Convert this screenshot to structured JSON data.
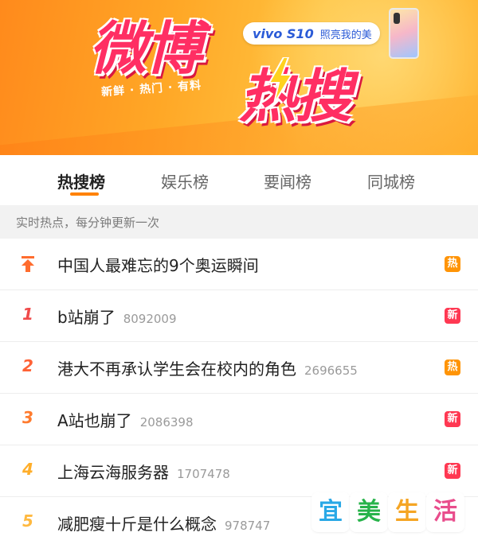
{
  "banner": {
    "title_main": "微博",
    "title_hot": "热搜",
    "subtitle": "新鲜 · 热门 · 有料",
    "ad_brand": "vivo S10",
    "ad_text": "照亮我的美"
  },
  "tabs": [
    {
      "label": "热搜榜",
      "active": true
    },
    {
      "label": "娱乐榜",
      "active": false
    },
    {
      "label": "要闻榜",
      "active": false
    },
    {
      "label": "同城榜",
      "active": false
    }
  ],
  "notice": "实时热点，每分钟更新一次",
  "rows": [
    {
      "rank": "",
      "pinned": true,
      "title": "中国人最难忘的9个奥运瞬间",
      "count": "",
      "badge": "热"
    },
    {
      "rank": "1",
      "title": "b站崩了",
      "count": "8092009",
      "badge": "新"
    },
    {
      "rank": "2",
      "title": "港大不再承认学生会在校内的角色",
      "count": "2696655",
      "badge": "热"
    },
    {
      "rank": "3",
      "title": "A站也崩了",
      "count": "2086398",
      "badge": "新"
    },
    {
      "rank": "4",
      "title": "上海云海服务器",
      "count": "1707478",
      "badge": "新"
    },
    {
      "rank": "5",
      "title": "减肥瘦十斤是什么概念",
      "count": "978747",
      "badge": ""
    }
  ],
  "watermark": [
    "宜",
    "美",
    "生",
    "活"
  ],
  "colors": {
    "accent": "#ff8200",
    "hot_badge": "#ff9406",
    "new_badge": "#ff3852",
    "title_pink": "#ff2e63"
  }
}
